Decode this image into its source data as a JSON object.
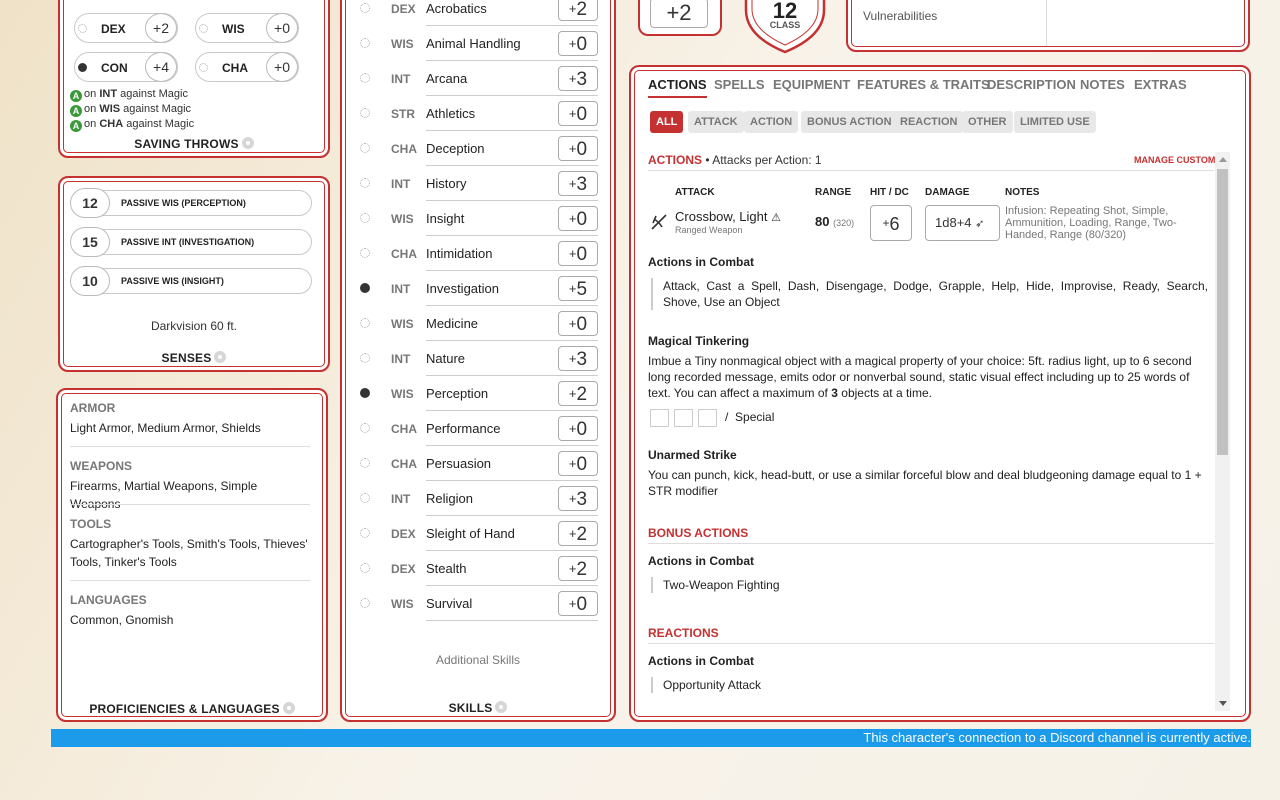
{
  "saving_throws": {
    "title": "SAVING THROWS",
    "items": [
      {
        "abbr": "DEX",
        "mod": "+2",
        "proficient": false
      },
      {
        "abbr": "WIS",
        "mod": "+0",
        "proficient": false
      },
      {
        "abbr": "CON",
        "mod": "+4",
        "proficient": true
      },
      {
        "abbr": "CHA",
        "mod": "+0",
        "proficient": false
      }
    ],
    "advantages": [
      {
        "on": "on",
        "ability": "INT",
        "text": "against Magic"
      },
      {
        "on": "on",
        "ability": "WIS",
        "text": "against Magic"
      },
      {
        "on": "on",
        "ability": "CHA",
        "text": "against Magic"
      }
    ],
    "adv_icon_letter": "A"
  },
  "senses": {
    "title": "SENSES",
    "items": [
      {
        "value": "12",
        "label": "PASSIVE WIS (PERCEPTION)"
      },
      {
        "value": "15",
        "label": "PASSIVE INT (INVESTIGATION)"
      },
      {
        "value": "10",
        "label": "PASSIVE WIS (INSIGHT)"
      }
    ],
    "darkvision": "Darkvision 60 ft."
  },
  "proficiencies": {
    "title": "PROFICIENCIES & LANGUAGES",
    "armor": {
      "heading": "ARMOR",
      "text": "Light Armor, Medium Armor, Shields"
    },
    "weapons": {
      "heading": "WEAPONS",
      "text": "Firearms, Martial Weapons, Simple Weapons"
    },
    "tools": {
      "heading": "TOOLS",
      "text": "Cartographer's Tools, Smith's Tools, Thieves' Tools, Tinker's Tools"
    },
    "languages": {
      "heading": "LANGUAGES",
      "text": "Common, Gnomish"
    }
  },
  "skills": {
    "title": "SKILLS",
    "additional": "Additional Skills",
    "items": [
      {
        "ab": "DEX",
        "name": "Acrobatics",
        "sign": "+",
        "val": "2",
        "prof": false
      },
      {
        "ab": "WIS",
        "name": "Animal Handling",
        "sign": "+",
        "val": "0",
        "prof": false
      },
      {
        "ab": "INT",
        "name": "Arcana",
        "sign": "+",
        "val": "3",
        "prof": false
      },
      {
        "ab": "STR",
        "name": "Athletics",
        "sign": "+",
        "val": "0",
        "prof": false
      },
      {
        "ab": "CHA",
        "name": "Deception",
        "sign": "+",
        "val": "0",
        "prof": false
      },
      {
        "ab": "INT",
        "name": "History",
        "sign": "+",
        "val": "3",
        "prof": false
      },
      {
        "ab": "WIS",
        "name": "Insight",
        "sign": "+",
        "val": "0",
        "prof": false
      },
      {
        "ab": "CHA",
        "name": "Intimidation",
        "sign": "+",
        "val": "0",
        "prof": false
      },
      {
        "ab": "INT",
        "name": "Investigation",
        "sign": "+",
        "val": "5",
        "prof": true
      },
      {
        "ab": "WIS",
        "name": "Medicine",
        "sign": "+",
        "val": "0",
        "prof": false
      },
      {
        "ab": "INT",
        "name": "Nature",
        "sign": "+",
        "val": "3",
        "prof": false
      },
      {
        "ab": "WIS",
        "name": "Perception",
        "sign": "+",
        "val": "2",
        "prof": true
      },
      {
        "ab": "CHA",
        "name": "Performance",
        "sign": "+",
        "val": "0",
        "prof": false
      },
      {
        "ab": "CHA",
        "name": "Persuasion",
        "sign": "+",
        "val": "0",
        "prof": false
      },
      {
        "ab": "INT",
        "name": "Religion",
        "sign": "+",
        "val": "3",
        "prof": false
      },
      {
        "ab": "DEX",
        "name": "Sleight of Hand",
        "sign": "+",
        "val": "2",
        "prof": false
      },
      {
        "ab": "DEX",
        "name": "Stealth",
        "sign": "+",
        "val": "2",
        "prof": false
      },
      {
        "ab": "WIS",
        "name": "Survival",
        "sign": "+",
        "val": "0",
        "prof": false
      }
    ]
  },
  "top": {
    "initiative": "+2",
    "ac_value": "12",
    "ac_label": "CLASS",
    "defenses_text": "Vulnerabilities"
  },
  "actions": {
    "tabs": [
      "ACTIONS",
      "SPELLS",
      "EQUIPMENT",
      "FEATURES & TRAITS",
      "DESCRIPTION",
      "NOTES",
      "EXTRAS"
    ],
    "filters": [
      "ALL",
      "ATTACK",
      "ACTION",
      "BONUS ACTION",
      "REACTION",
      "OTHER",
      "LIMITED USE"
    ],
    "section_title": "ACTIONS",
    "attacks_per_action": "• Attacks per Action: 1",
    "manage_custom": "MANAGE CUSTOM",
    "table_headers": {
      "attack": "ATTACK",
      "range": "RANGE",
      "hit": "HIT / DC",
      "damage": "DAMAGE",
      "notes": "NOTES"
    },
    "weapon": {
      "name": "Crossbow, Light",
      "type": "Ranged Weapon",
      "range": "80",
      "range_long": "(320)",
      "hit_sign": "+",
      "hit": "6",
      "damage": "1d8+4",
      "notes": "Infusion: Repeating Shot, Simple, Ammunition, Loading, Range, Two-Handed, Range (80/320)"
    },
    "combat_heading": "Actions in Combat",
    "combat_list": "Attack, Cast a Spell, Dash, Disengage, Dodge, Grapple, Help, Hide, Improvise, Ready, Search, Shove, Use an Object",
    "tinkering_heading": "Magical Tinkering",
    "tinkering_text_a": "Imbue a Tiny nonmagical object with a magical property of your choice: 5ft. radius light, up to 6 second long recorded message, emits odor or nonverbal sound, static visual effect including up to 25 words of text. You can affect a maximum of",
    "tinkering_count": "3",
    "tinkering_text_b": "objects at a time.",
    "uses_separator": "/",
    "uses_label": "Special",
    "unarmed_heading": "Unarmed Strike",
    "unarmed_text": "You can punch, kick, head-butt, or use a similar forceful blow and deal bludgeoning damage equal to 1 + STR modifier",
    "bonus_title": "BONUS ACTIONS",
    "bonus_combat_heading": "Actions in Combat",
    "bonus_item": "Two-Weapon Fighting",
    "reactions_title": "REACTIONS",
    "reaction_combat_heading": "Actions in Combat",
    "reaction_item": "Opportunity Attack"
  },
  "discord_banner": "This character's connection to a Discord channel is currently active.",
  "colors": {
    "accent": "#c53131",
    "banner": "#1b9bea",
    "proficient_dot": "#333333"
  }
}
